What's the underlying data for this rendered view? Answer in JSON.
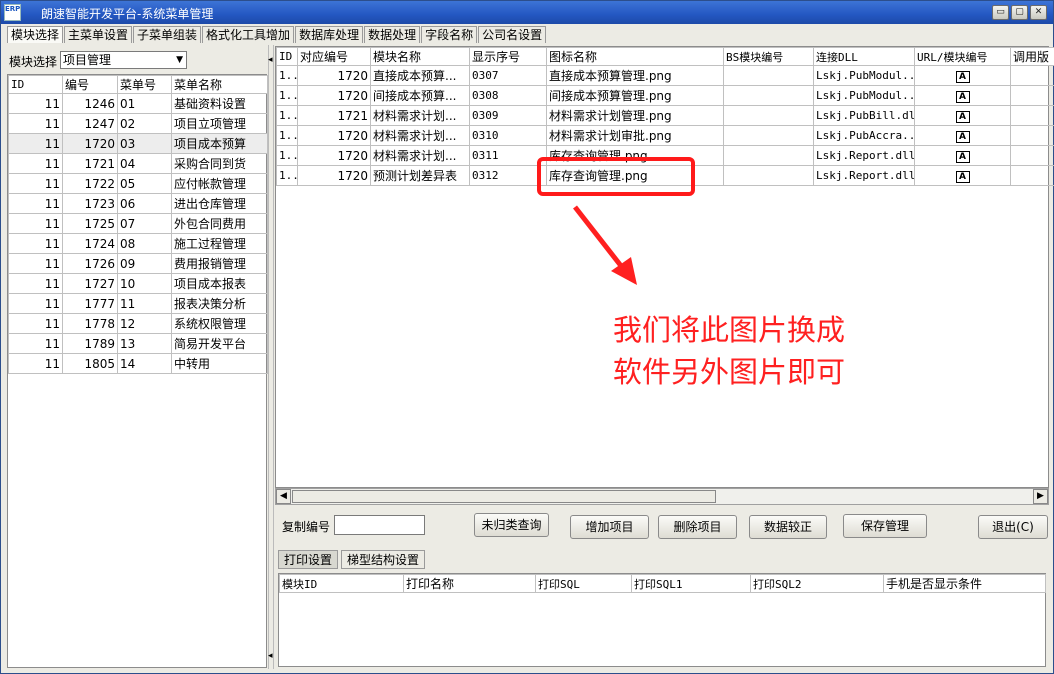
{
  "window": {
    "title": "朗速智能开发平台-系统菜单管理",
    "app_icon": "ERP"
  },
  "window_buttons": [
    "▭",
    "▢",
    "✕"
  ],
  "tabs": [
    "模块选择",
    "主菜单设置",
    "子菜单组装",
    "格式化工具增加",
    "数据库处理",
    "数据处理",
    "字段名称",
    "公司名设置"
  ],
  "left": {
    "module_label": "模块选择",
    "module_value": "项目管理",
    "headers": [
      "ID",
      "编号",
      "菜单号",
      "菜单名称"
    ],
    "rows": [
      [
        "11",
        "1246",
        "01",
        "基础资料设置"
      ],
      [
        "11",
        "1247",
        "02",
        "项目立项管理"
      ],
      [
        "11",
        "1720",
        "03",
        "项目成本预算"
      ],
      [
        "11",
        "1721",
        "04",
        "采购合同到货"
      ],
      [
        "11",
        "1722",
        "05",
        "应付帐款管理"
      ],
      [
        "11",
        "1723",
        "06",
        "进出仓库管理"
      ],
      [
        "11",
        "1725",
        "07",
        "外包合同费用"
      ],
      [
        "11",
        "1724",
        "08",
        "施工过程管理"
      ],
      [
        "11",
        "1726",
        "09",
        "费用报销管理"
      ],
      [
        "11",
        "1727",
        "10",
        "项目成本报表"
      ],
      [
        "11",
        "1777",
        "11",
        "报表决策分析"
      ],
      [
        "11",
        "1778",
        "12",
        "系统权限管理"
      ],
      [
        "11",
        "1789",
        "13",
        "简易开发平台"
      ],
      [
        "11",
        "1805",
        "14",
        "中转用"
      ]
    ]
  },
  "right": {
    "headers": [
      "ID",
      "对应编号",
      "模块名称",
      "显示序号",
      "图标名称",
      "BS模块编号",
      "连接DLL",
      "URL/模块编号",
      "调用版"
    ],
    "rows": [
      [
        "1..",
        "1720",
        "直接成本预算...",
        "0307",
        "直接成本预算管理.png",
        "",
        "Lskj.PubModul..."
      ],
      [
        "1..",
        "1720",
        "间接成本预算...",
        "0308",
        "间接成本预算管理.png",
        "",
        "Lskj.PubModul..."
      ],
      [
        "1..",
        "1721",
        "材料需求计划...",
        "0309",
        "材料需求计划管理.png",
        "",
        "Lskj.PubBill.dll"
      ],
      [
        "1..",
        "1720",
        "材料需求计划...",
        "0310",
        "材料需求计划审批.png",
        "",
        "Lskj.PubAccra..."
      ],
      [
        "1..",
        "1720",
        "材料需求计划...",
        "0311",
        "库存查询管理.png",
        "",
        "Lskj.Report.dll"
      ],
      [
        "1..",
        "1720",
        "预测计划差异表",
        "0312",
        "库存查询管理.png",
        "",
        "Lskj.Report.dll"
      ]
    ],
    "url_icon": "A"
  },
  "bottom": {
    "copy_label": "复制编号",
    "copy_value": "",
    "buttons": {
      "unclassified": "未归类查询",
      "add": "增加项目",
      "delete": "删除项目",
      "check": "数据较正",
      "save": "保存管理",
      "exit": "退出(C)"
    },
    "subtabs": [
      "打印设置",
      "梯型结构设置"
    ],
    "print_headers": [
      "模块ID",
      "打印名称",
      "打印SQL",
      "打印SQL1",
      "打印SQL2",
      "手机是否显示条件"
    ]
  },
  "annotation": {
    "lines": [
      "我们将此图片换成",
      "软件另外图片即可"
    ],
    "color": "#ff2020"
  }
}
